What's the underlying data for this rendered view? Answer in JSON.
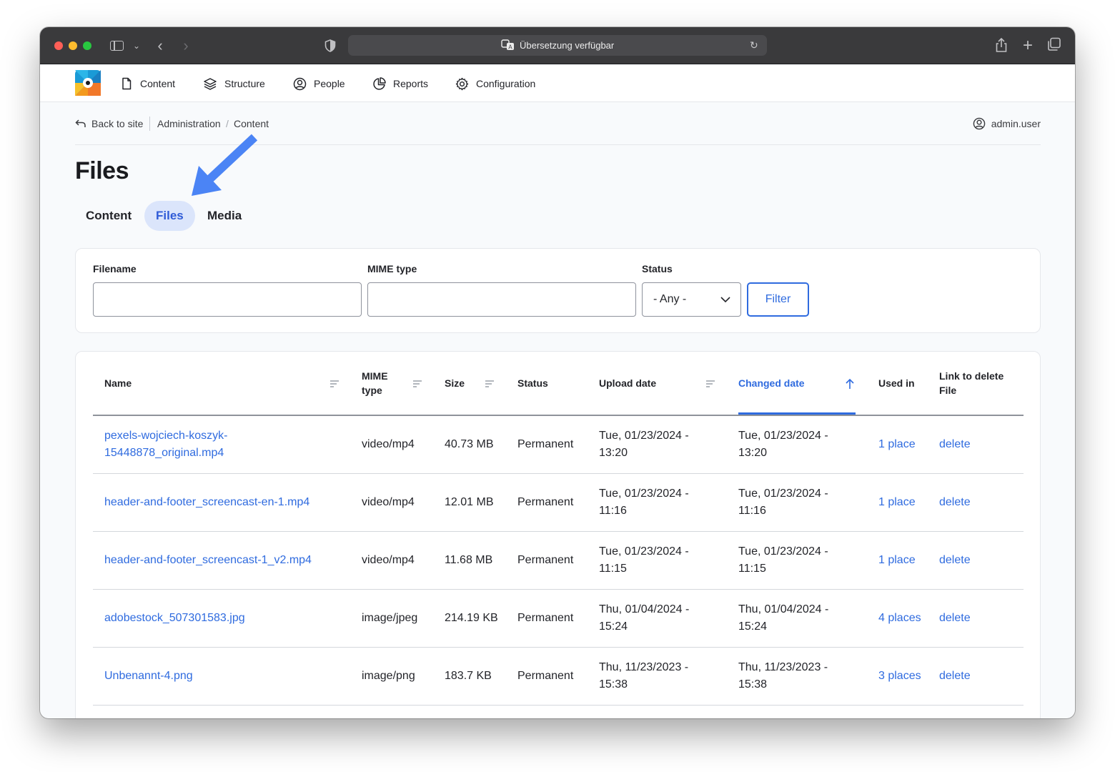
{
  "browser": {
    "url_text": "Übersetzung verfügbar"
  },
  "nav": {
    "items": [
      {
        "label": "Content",
        "icon": "document-icon"
      },
      {
        "label": "Structure",
        "icon": "layers-icon"
      },
      {
        "label": "People",
        "icon": "user-circle-icon"
      },
      {
        "label": "Reports",
        "icon": "pie-chart-icon"
      },
      {
        "label": "Configuration",
        "icon": "gear-icon"
      }
    ]
  },
  "breadcrumb": {
    "back": "Back to site",
    "admin": "Administration",
    "separator": "/",
    "content": "Content"
  },
  "user": {
    "name": "admin.user"
  },
  "page": {
    "title": "Files"
  },
  "tabs": [
    {
      "label": "Content",
      "active": false
    },
    {
      "label": "Files",
      "active": true
    },
    {
      "label": "Media",
      "active": false
    }
  ],
  "filters": {
    "filename_label": "Filename",
    "filename_value": "",
    "mime_label": "MIME type",
    "mime_value": "",
    "status_label": "Status",
    "status_value": "- Any -",
    "submit_label": "Filter"
  },
  "table": {
    "columns": [
      {
        "label": "Name",
        "sortable": true
      },
      {
        "label": "MIME type",
        "sortable": true
      },
      {
        "label": "Size",
        "sortable": true
      },
      {
        "label": "Status",
        "sortable": false
      },
      {
        "label": "Upload date",
        "sortable": true
      },
      {
        "label": "Changed date",
        "sortable": true,
        "active": true,
        "direction": "asc"
      },
      {
        "label": "Used in",
        "sortable": false
      },
      {
        "label": "Link to delete File",
        "sortable": false
      }
    ],
    "rows": [
      {
        "name": "pexels-wojciech-koszyk-15448878_original.mp4",
        "mime": "video/mp4",
        "size": "40.73 MB",
        "status": "Permanent",
        "uploaded": "Tue, 01/23/2024 - 13:20",
        "changed": "Tue, 01/23/2024 - 13:20",
        "used_in": "1 place",
        "delete": "delete"
      },
      {
        "name": "header-and-footer_screencast-en-1.mp4",
        "mime": "video/mp4",
        "size": "12.01 MB",
        "status": "Permanent",
        "uploaded": "Tue, 01/23/2024 - 11:16",
        "changed": "Tue, 01/23/2024 - 11:16",
        "used_in": "1 place",
        "delete": "delete"
      },
      {
        "name": "header-and-footer_screencast-1_v2.mp4",
        "mime": "video/mp4",
        "size": "11.68 MB",
        "status": "Permanent",
        "uploaded": "Tue, 01/23/2024 - 11:15",
        "changed": "Tue, 01/23/2024 - 11:15",
        "used_in": "1 place",
        "delete": "delete"
      },
      {
        "name": "adobestock_507301583.jpg",
        "mime": "image/jpeg",
        "size": "214.19 KB",
        "status": "Permanent",
        "uploaded": "Thu, 01/04/2024 - 15:24",
        "changed": "Thu, 01/04/2024 - 15:24",
        "used_in": "4 places",
        "delete": "delete"
      },
      {
        "name": "Unbenannt-4.png",
        "mime": "image/png",
        "size": "183.7 KB",
        "status": "Permanent",
        "uploaded": "Thu, 11/23/2023 - 15:38",
        "changed": "Thu, 11/23/2023 - 15:38",
        "used_in": "3 places",
        "delete": "delete"
      }
    ]
  },
  "colors": {
    "accent": "#2f6bdf",
    "active_tab_bg": "#dbe5fb",
    "annotation_arrow": "#4b84f5"
  }
}
